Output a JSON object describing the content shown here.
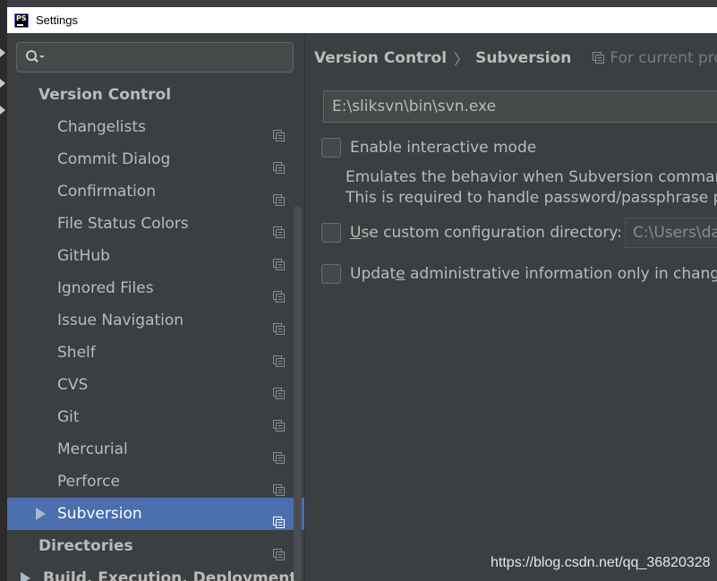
{
  "window": {
    "title": "Settings",
    "app_icon_text": "PS"
  },
  "search": {
    "value": ""
  },
  "tree": {
    "items": [
      {
        "label": "Version Control",
        "level": 0,
        "bold": true,
        "project_icon": false,
        "selected": false
      },
      {
        "label": "Changelists",
        "level": 1,
        "project_icon": true
      },
      {
        "label": "Commit Dialog",
        "level": 1,
        "project_icon": true
      },
      {
        "label": "Confirmation",
        "level": 1,
        "project_icon": true
      },
      {
        "label": "File Status Colors",
        "level": 1,
        "project_icon": true
      },
      {
        "label": "GitHub",
        "level": 1,
        "project_icon": true
      },
      {
        "label": "Ignored Files",
        "level": 1,
        "project_icon": true
      },
      {
        "label": "Issue Navigation",
        "level": 1,
        "project_icon": true
      },
      {
        "label": "Shelf",
        "level": 1,
        "project_icon": true
      },
      {
        "label": "CVS",
        "level": 1,
        "project_icon": true
      },
      {
        "label": "Git",
        "level": 1,
        "project_icon": true
      },
      {
        "label": "Mercurial",
        "level": 1,
        "project_icon": true
      },
      {
        "label": "Perforce",
        "level": 1,
        "project_icon": true
      },
      {
        "label": "Subversion",
        "level": 1,
        "project_icon": true,
        "selected": true,
        "expandable": true
      },
      {
        "label": "Directories",
        "level": 0,
        "bold": true,
        "project_icon": true
      },
      {
        "label": "Build, Execution, Deployment",
        "level": 0,
        "bold": true,
        "project_icon": false,
        "expandable": true
      }
    ]
  },
  "breadcrumb": {
    "parent": "Version Control",
    "separator": "〉",
    "current": "Subversion",
    "scope_hint": "For current project"
  },
  "subversion": {
    "svn_path": "E:\\sliksvn\\bin\\svn.exe",
    "interactive_mode": {
      "label": "Enable interactive mode",
      "checked": false,
      "description_line1": "Emulates the behavior when Subversion commands",
      "description_line2": "This is required to handle password/passphrase pro"
    },
    "custom_config": {
      "label_mnemonic": "U",
      "label_rest": "se custom configuration directory:",
      "checked": false,
      "directory_value": "C:\\Users\\da"
    },
    "update_admin": {
      "label_pre": "Updat",
      "label_mnemonic": "e",
      "label_post": " administrative information only in changed",
      "checked": false
    }
  },
  "watermark": "https://blog.csdn.net/qq_36820328",
  "colors": {
    "background": "#3c3f41",
    "selection": "#4b6eaf",
    "text": "#bbbbbb"
  }
}
